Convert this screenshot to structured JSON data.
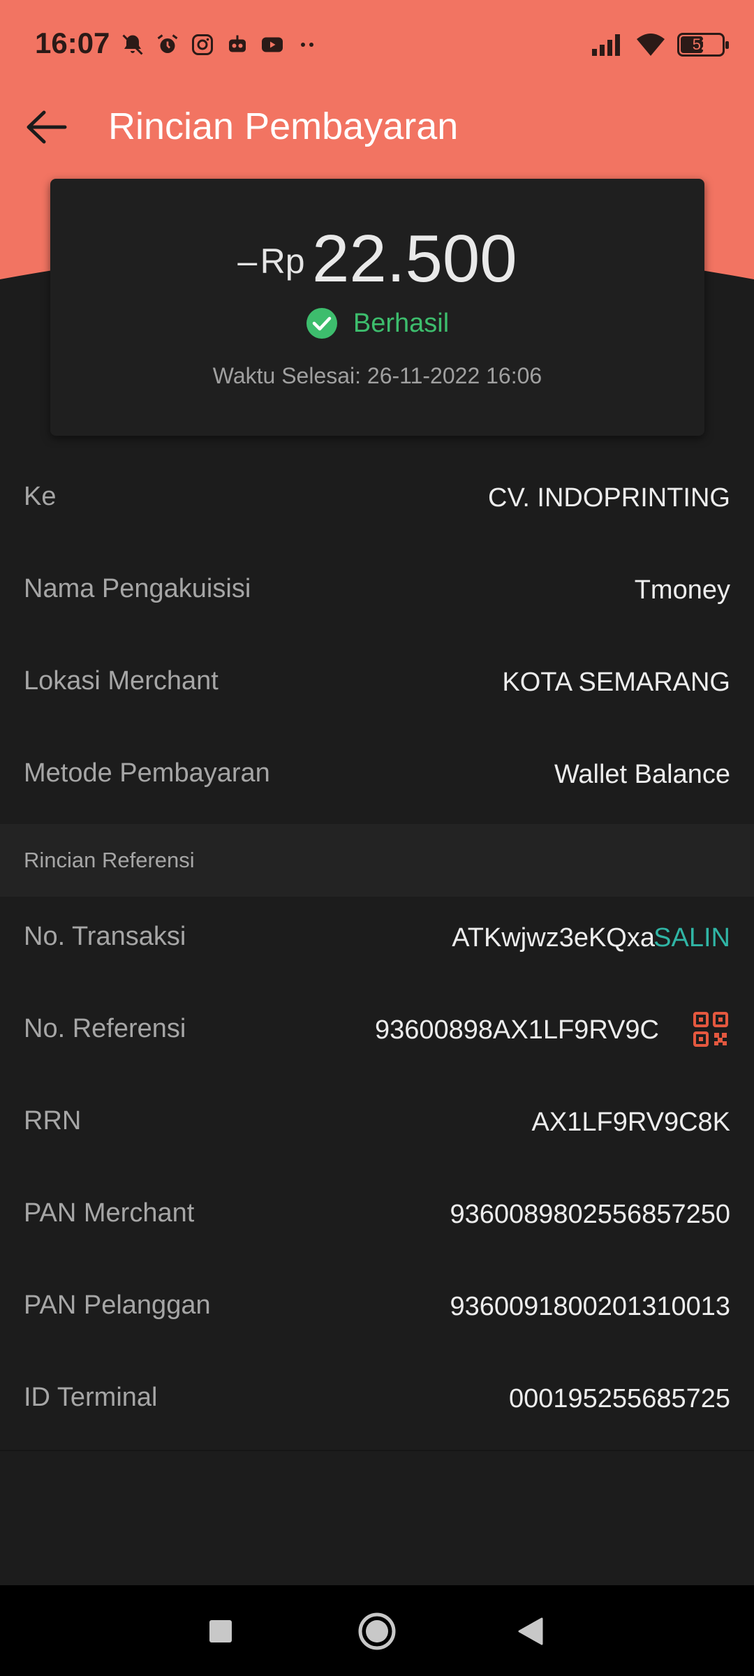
{
  "status_bar": {
    "time": "16:07",
    "battery": "52",
    "left_icons": [
      "bell-off-icon",
      "alarm-icon",
      "instagram-icon",
      "robot-icon",
      "youtube-icon",
      "more-dots-icon"
    ],
    "right_icons": [
      "signal-icon",
      "wifi-icon",
      "battery-icon"
    ]
  },
  "appbar": {
    "title": "Rincian Pembayaran",
    "back_icon": "arrow-left-icon"
  },
  "summary": {
    "sign": "–",
    "currency": "Rp",
    "amount": "22.500",
    "status": "Berhasil",
    "finish_time": "Waktu Selesai: 26-11-2022 16:06"
  },
  "details": [
    {
      "label": "Ke",
      "value": "CV. INDOPRINTING"
    },
    {
      "label": "Nama Pengakuisisi",
      "value": "Tmoney"
    },
    {
      "label": "Lokasi Merchant",
      "value": "KOTA SEMARANG"
    },
    {
      "label": "Metode Pembayaran",
      "value": "Wallet Balance"
    }
  ],
  "reference_section": {
    "title": "Rincian Referensi",
    "copy_label": "SALIN",
    "rows": [
      {
        "label": "No. Transaksi",
        "value": "ATKwjwz3eKQxa"
      },
      {
        "label": "No. Referensi",
        "value": "93600898AX1LF9RV9C"
      },
      {
        "label": "RRN",
        "value": "AX1LF9RV9C8K"
      },
      {
        "label": "PAN Merchant",
        "value": "9360089802556857250"
      },
      {
        "label": "PAN Pelanggan",
        "value": "9360091800201310013"
      },
      {
        "label": "ID Terminal",
        "value": "000195255685725"
      }
    ]
  },
  "colors": {
    "header": "#f27462",
    "background": "#1c1c1c",
    "success": "#3dbd6d",
    "copy_accent": "#30b5a5",
    "qr_accent": "#e4583f"
  },
  "nav_bar": {
    "icons": [
      "recents-square-icon",
      "home-circle-icon",
      "back-triangle-icon"
    ]
  }
}
